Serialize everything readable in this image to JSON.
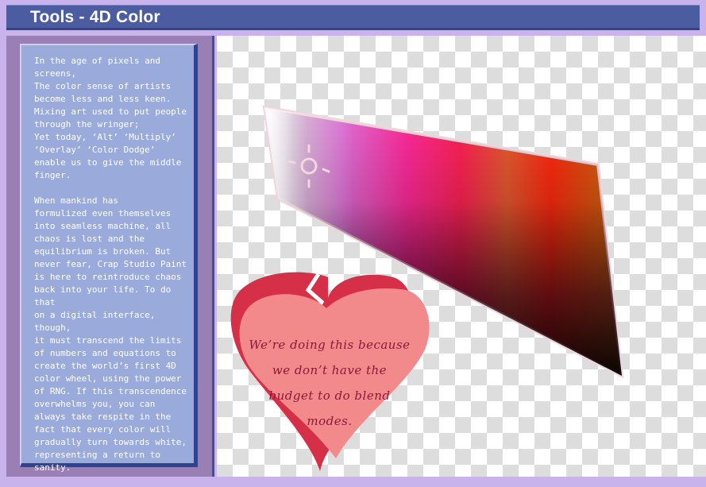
{
  "window": {
    "title": "Tools - 4D Color"
  },
  "panel": {
    "paragraphs": [
      "In the age of pixels and\nscreens,\nThe color sense of artists\nbecome less and less keen.\nMixing art used to put people\nthrough the wringer;\nYet today, ‘Alt’ ‘Multiply’\n‘Overlay’ ‘Color Dodge’\nenable us to give the middle\nfinger.",
      "When mankind has\nformulized even themselves\ninto seamless machine, all\nchaos is lost and the\nequilibrium is broken. But\nnever fear, Crap Studio Paint\nis here to reintroduce chaos\nback into your life. To do that\non a digital interface, though,\nit must transcend the limits\nof numbers and equations to\ncreate the world’s first 4D\ncolor wheel, using the power\nof RNG. If this transcendence\noverwhelms you, you can\nalways take respite in the\nfact that every color will\ngradually turn towards white,\nrepresenting a return to\nsanity."
    ]
  },
  "canvas": {
    "picker_icon": "crosshair-icon",
    "heart_note": "We’re doing this because\nwe don’t have the\nbudget to do blend\nmodes."
  },
  "colors": {
    "titlebar": "#4c5ca0",
    "panel": "#9a7fb5",
    "card": "#9aaada",
    "heart_outer": "#d63048",
    "heart_inner": "#f28a8c"
  }
}
